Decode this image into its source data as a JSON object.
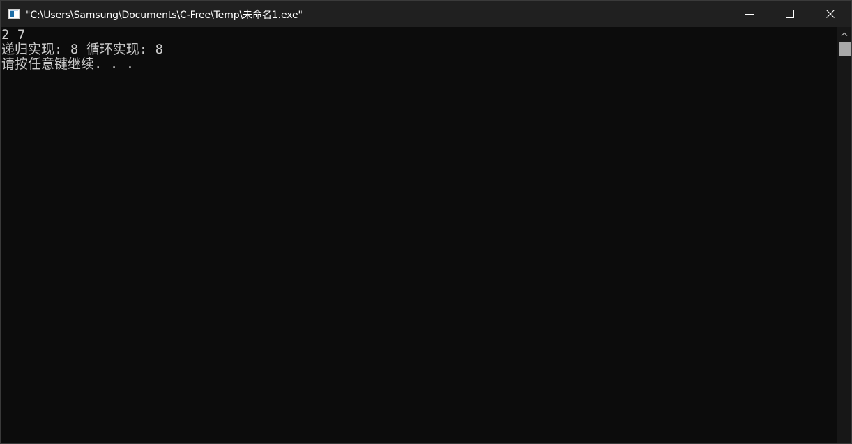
{
  "window": {
    "title": "\"C:\\Users\\Samsung\\Documents\\C-Free\\Temp\\未命名1.exe\"",
    "app_icon": "console-app-icon",
    "controls": {
      "minimize_icon": "minimize-icon",
      "maximize_icon": "maximize-icon",
      "close_icon": "close-icon"
    }
  },
  "console": {
    "lines": [
      "2 7",
      "递归实现: 8 循环实现: 8",
      "请按任意键继续. . ."
    ],
    "text_color": "#cccccc",
    "background_color": "#0c0c0c"
  },
  "scrollbar": {
    "up_icon": "chevron-up-icon"
  }
}
